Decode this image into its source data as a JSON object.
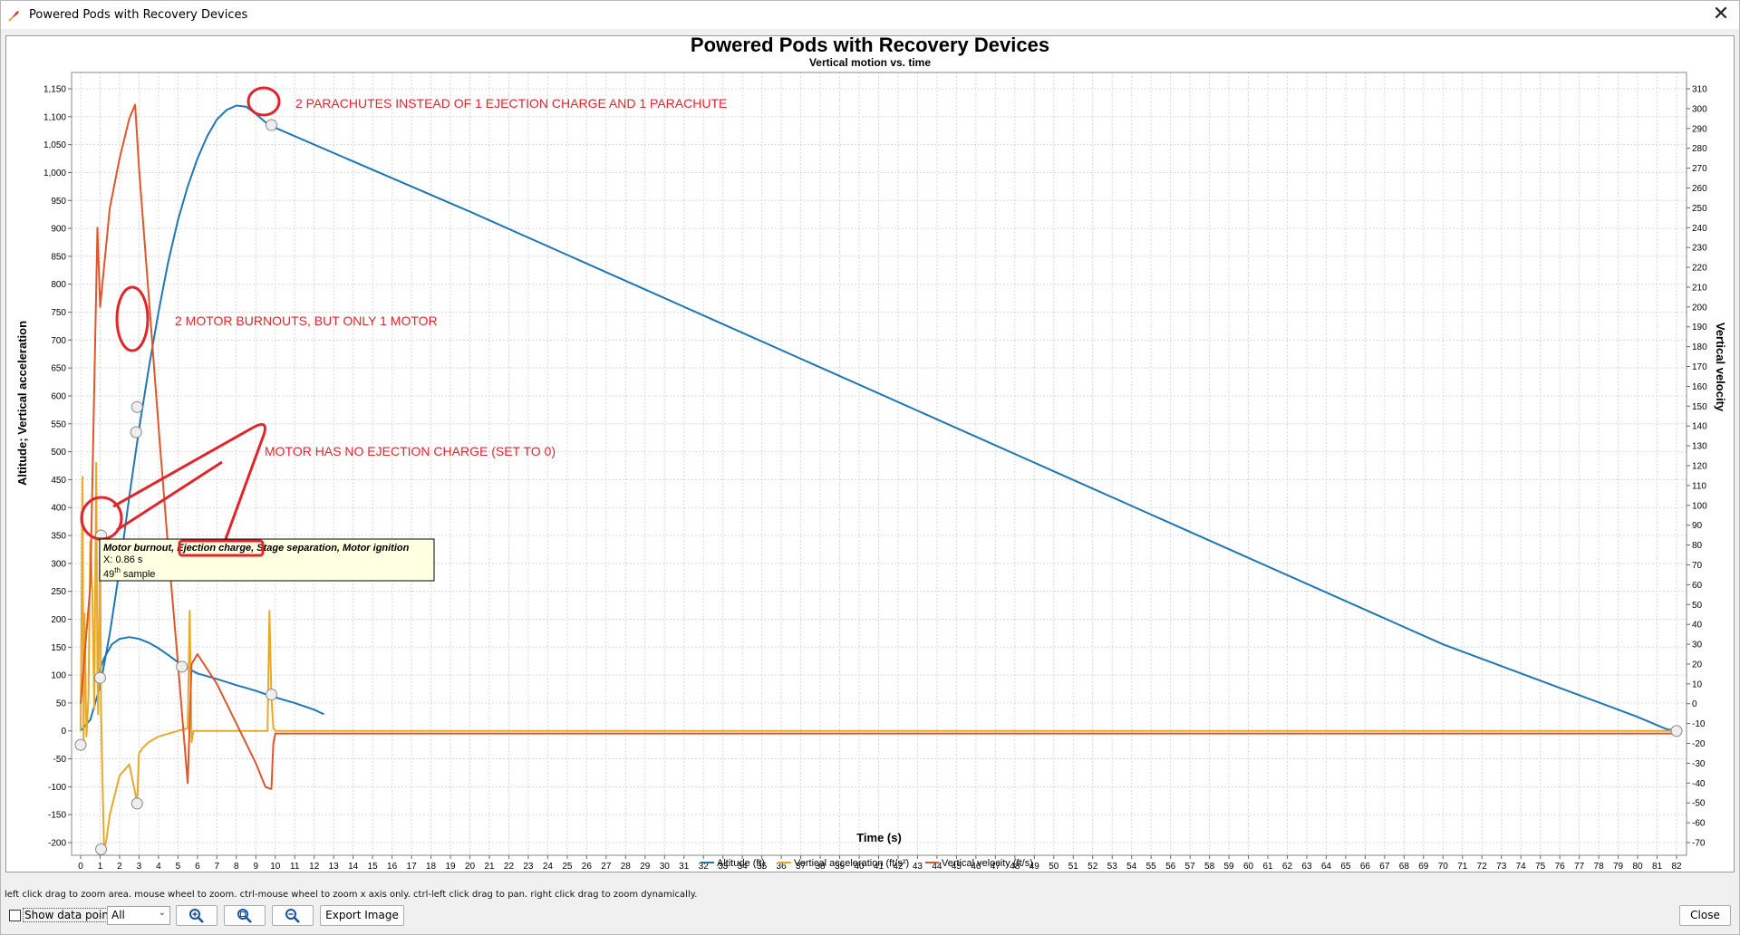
{
  "window": {
    "title": "Powered Pods with Recovery Devices",
    "close_glyph": "✕"
  },
  "chart_data": {
    "type": "line",
    "title": "Powered Pods with Recovery Devices",
    "subtitle": "Vertical motion vs. time",
    "xlabel": "Time (s)",
    "ylabel_left": "Altitude; Vertical acceleration",
    "ylabel_right": "Vertical velocity",
    "xlim": [
      0,
      82
    ],
    "ylim_left": [
      -200,
      1150
    ],
    "ylim_right": [
      -70,
      310
    ],
    "x_ticks": [
      0,
      1,
      2,
      3,
      4,
      5,
      6,
      7,
      8,
      9,
      10,
      11,
      12,
      13,
      14,
      15,
      16,
      17,
      18,
      19,
      20,
      21,
      22,
      23,
      24,
      25,
      26,
      27,
      28,
      29,
      30,
      31,
      32,
      33,
      34,
      35,
      36,
      37,
      38,
      39,
      40,
      41,
      42,
      43,
      44,
      45,
      46,
      47,
      48,
      49,
      50,
      51,
      52,
      53,
      54,
      55,
      56,
      57,
      58,
      59,
      60,
      61,
      62,
      63,
      64,
      65,
      66,
      67,
      68,
      69,
      70,
      71,
      72,
      73,
      74,
      75,
      76,
      77,
      78,
      79,
      80,
      81,
      82
    ],
    "y_ticks_left": [
      "-200",
      "-150",
      "-100",
      "-50",
      "0",
      "50",
      "100",
      "150",
      "200",
      "250",
      "300",
      "350",
      "400",
      "450",
      "500",
      "550",
      "600",
      "650",
      "700",
      "750",
      "800",
      "850",
      "900",
      "950",
      "1,000",
      "1,050",
      "1,100",
      "1,150"
    ],
    "y_ticks_right": [
      "-70",
      "-60",
      "-50",
      "-40",
      "-30",
      "-20",
      "-10",
      "0",
      "10",
      "20",
      "30",
      "40",
      "50",
      "60",
      "70",
      "80",
      "90",
      "100",
      "110",
      "120",
      "130",
      "140",
      "150",
      "160",
      "170",
      "180",
      "190",
      "200",
      "210",
      "220",
      "230",
      "240",
      "250",
      "260",
      "270",
      "280",
      "290",
      "300",
      "310"
    ],
    "grid": true,
    "legend_position": "bottom",
    "series": [
      {
        "name": "Altitude (ft)",
        "axis": "left",
        "color": "#1f77b4",
        "x": [
          0,
          0.5,
          1.0,
          1.5,
          2.0,
          2.5,
          3.0,
          3.5,
          4.0,
          4.5,
          5.0,
          5.5,
          6.0,
          6.5,
          7.0,
          7.5,
          8.0,
          8.5,
          9.0,
          9.5,
          10.0,
          20,
          30,
          40,
          50,
          60,
          70,
          80,
          81.5,
          82
        ],
        "y": [
          0,
          20,
          80,
          175,
          290,
          420,
          540,
          650,
          750,
          840,
          915,
          975,
          1025,
          1065,
          1095,
          1112,
          1120,
          1118,
          1105,
          1090,
          1080,
          930,
          775,
          620,
          465,
          310,
          155,
          25,
          3,
          0
        ]
      },
      {
        "name": "Altitude (ft)",
        "axis": "left",
        "color": "#1f77b4",
        "x": [
          0.9,
          1.2,
          1.6,
          2.0,
          2.5,
          3.0,
          3.5,
          4.0,
          4.5,
          5.0,
          5.5,
          6.0,
          7.0,
          8.0,
          9.0,
          9.8,
          11,
          12,
          12.5
        ],
        "y": [
          100,
          130,
          155,
          165,
          168,
          165,
          158,
          148,
          136,
          123,
          112,
          103,
          93,
          82,
          72,
          62,
          50,
          38,
          30
        ]
      },
      {
        "name": "Vertical acceleration (ft/s²)",
        "axis": "left",
        "color": "#e8a92a",
        "x": [
          0,
          0.1,
          0.15,
          0.2,
          0.3,
          0.4,
          0.5,
          0.6,
          0.7,
          0.8,
          0.86,
          0.9,
          1.0,
          1.05,
          1.1,
          1.2,
          1.3,
          1.5,
          2.0,
          2.5,
          2.9,
          3.0,
          3.2,
          3.5,
          4.0,
          4.5,
          5.0,
          5.5,
          5.6,
          5.7,
          5.8,
          5.9,
          6.0,
          7,
          8,
          9,
          9.6,
          9.7,
          9.8,
          9.9,
          10.0,
          10.2,
          11,
          20,
          30,
          40,
          50,
          60,
          70,
          80,
          82
        ],
        "y": [
          0,
          455,
          -30,
          210,
          -10,
          60,
          340,
          250,
          40,
          480,
          100,
          30,
          360,
          40,
          -50,
          -212,
          -200,
          -150,
          -80,
          -60,
          -128,
          -40,
          -30,
          -20,
          -10,
          -5,
          0,
          5,
          215,
          -20,
          0,
          0,
          0,
          0,
          0,
          0,
          0,
          215,
          60,
          5,
          0,
          0,
          0,
          0,
          0,
          0,
          0,
          0,
          0,
          0,
          0
        ]
      },
      {
        "name": "Vertical velocity (ft/s)",
        "axis": "right",
        "color": "#e0562a",
        "x": [
          0,
          0.5,
          0.86,
          1.0,
          1.5,
          2.0,
          2.5,
          2.8,
          3.0,
          3.5,
          4.0,
          4.5,
          5.0,
          5.5,
          5.6,
          5.7,
          6.0,
          7.0,
          8.0,
          9.0,
          9.5,
          9.8,
          9.9,
          10.0,
          11,
          20,
          30,
          40,
          50,
          60,
          70,
          80,
          82
        ],
        "y": [
          0,
          60,
          240,
          200,
          250,
          275,
          295,
          302,
          270,
          205,
          140,
          78,
          20,
          -40,
          -10,
          20,
          25,
          10,
          -10,
          -30,
          -42,
          -43,
          -20,
          -15,
          -15,
          -15,
          -15,
          -15,
          -15,
          -15,
          -15,
          -15,
          -15
        ]
      }
    ],
    "event_markers": [
      {
        "x": 0.0,
        "y": -25,
        "axis": "left"
      },
      {
        "x": 1.0,
        "y": 95,
        "axis": "left"
      },
      {
        "x": 1.05,
        "y": 350,
        "axis": "left"
      },
      {
        "x": 1.05,
        "y": -212,
        "axis": "left"
      },
      {
        "x": 2.9,
        "y": 580,
        "axis": "left"
      },
      {
        "x": 2.85,
        "y": 535,
        "axis": "left"
      },
      {
        "x": 2.9,
        "y": -130,
        "axis": "left"
      },
      {
        "x": 5.2,
        "y": 115,
        "axis": "left"
      },
      {
        "x": 9.8,
        "y": 1085,
        "axis": "left"
      },
      {
        "x": 9.8,
        "y": 65,
        "axis": "left"
      },
      {
        "x": 82,
        "y": 0,
        "axis": "left"
      }
    ],
    "annotations": [
      {
        "text": "2 PARACHUTES INSTEAD OF 1 EJECTION CHARGE AND 1 PARACHUTE"
      },
      {
        "text": "2 MOTOR BURNOUTS, BUT ONLY 1 MOTOR"
      },
      {
        "text": "MOTOR HAS NO EJECTION CHARGE (SET TO 0)"
      }
    ],
    "tooltip": {
      "title": "Motor burnout, Ejection charge, Stage separation, Motor ignition",
      "x_line": "X: 0.86 s",
      "sample_num": "49",
      "sample_sup": "th",
      "sample_word": "sample"
    }
  },
  "hint": "left click drag to zoom area. mouse wheel to zoom. ctrl-mouse wheel to zoom x axis only. ctrl-left click drag to pan.  right click drag to zoom dynamically.",
  "controls": {
    "show_points_label": "Show data points",
    "show_points_checked": false,
    "filter_value": "All",
    "zoom_in_icon": "zoom-in-icon",
    "zoom_fit_icon": "zoom-fit-icon",
    "zoom_out_icon": "zoom-out-icon",
    "export_label": "Export Image",
    "close_label": "Close"
  }
}
